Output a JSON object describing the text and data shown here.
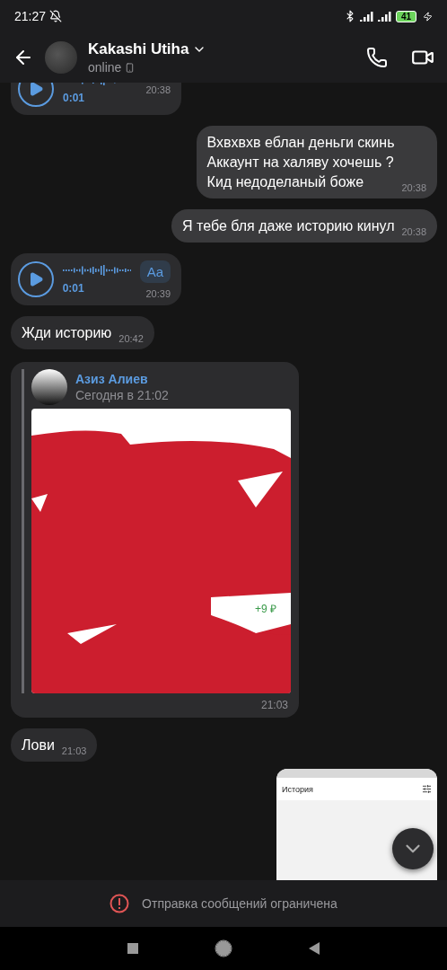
{
  "status_bar": {
    "time": "21:27",
    "battery": "41"
  },
  "header": {
    "name": "Kakashi Utiha",
    "status": "online"
  },
  "messages": [
    {
      "kind": "voice",
      "outgoing": false,
      "duration": "0:01",
      "time": "20:38"
    },
    {
      "kind": "text",
      "outgoing": true,
      "lines": [
        "Вхвхвхв еблан деньги скинь",
        "Аккаунт на халяву хочешь ?",
        "Кид недоделаный боже"
      ],
      "time": "20:38"
    },
    {
      "kind": "text",
      "outgoing": true,
      "lines": [
        "Я тебе бля даже историю кинул"
      ],
      "time": "20:38"
    },
    {
      "kind": "voice",
      "outgoing": false,
      "duration": "0:01",
      "transcribe": "Aa",
      "time": "20:39"
    },
    {
      "kind": "text",
      "outgoing": false,
      "lines": [
        "Жди историю"
      ],
      "time": "20:42"
    },
    {
      "kind": "forward",
      "outgoing": false,
      "author": "Азиз Алиев",
      "date": "Сегодня в 21:02",
      "amount": "+9 ₽",
      "time": "21:03"
    },
    {
      "kind": "text",
      "outgoing": false,
      "lines": [
        "Лови"
      ],
      "time": "21:03"
    },
    {
      "kind": "screenshot",
      "outgoing": true,
      "title": "История"
    }
  ],
  "notice": "Отправка сообщений ограничена"
}
